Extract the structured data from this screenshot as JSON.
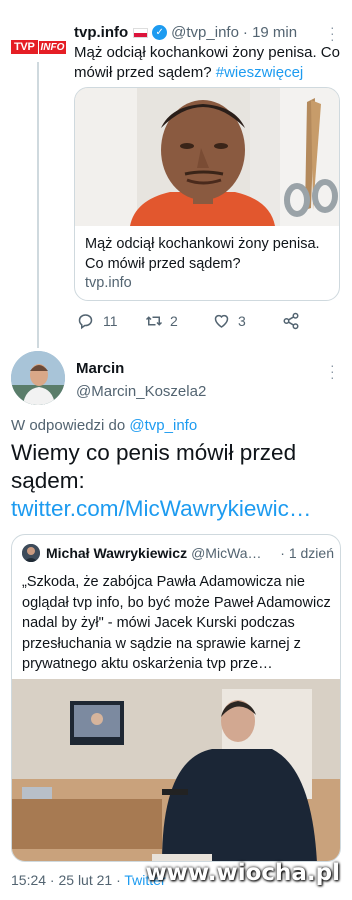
{
  "tweet1": {
    "logo_tvp": "TVP",
    "logo_info": "INFO",
    "name": "tvp.info",
    "handle": "@tvp_info",
    "time": "· 19 min",
    "text": "Mąż odciął kochankowi żony penisa. Co mówił przed sądem?",
    "hashtag": "#wieszwięcej",
    "card_title": "Mąż odciął kochankowi żony penisa. Co mówił przed sądem?",
    "card_domain": "tvp.info",
    "replies": "11",
    "retweets": "2",
    "likes": "3"
  },
  "reply": {
    "name": "Marcin",
    "handle": "@Marcin_Koszela2",
    "reply_prefix": "W odpowiedzi do",
    "reply_to": "@tvp_info",
    "text": "Wiemy co penis mówił przed sądem:",
    "link": "twitter.com/MicWawrykiewic…"
  },
  "quote": {
    "name": "Michał Wawrykiewicz",
    "handle": "@MicWa…",
    "time": "· 1 dzień",
    "text": "„Szkoda, że zabójca Pawła Adamowicza nie oglądał tvp info, bo być może Paweł Adamowicz nadal by żył\" - mówi Jacek Kurski podczas przesłuchania w sądzie na sprawie karnej z prywatnego aktu oskarżenia tvp prze…"
  },
  "footer": {
    "datetime": "15:24 · 25 lut 21 · ",
    "source": "Twitter"
  },
  "watermark": "www.wiocha.pl",
  "colors": {
    "accent": "#1d9bf0",
    "muted": "#536471",
    "border": "#cfd9de",
    "tvp_red": "#e51e25"
  },
  "icons": [
    "verified-icon",
    "reply-icon",
    "retweet-icon",
    "like-icon",
    "share-icon",
    "more-icon"
  ]
}
